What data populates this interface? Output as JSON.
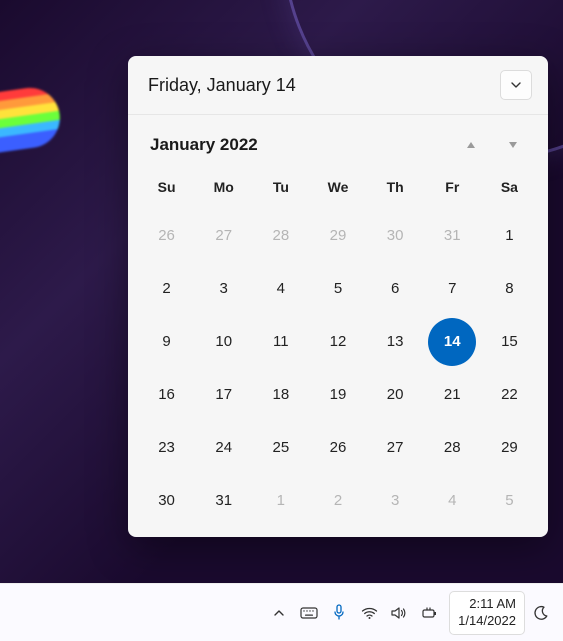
{
  "calendar": {
    "header_date": "Friday, January 14",
    "month_label": "January 2022",
    "days_of_week": [
      "Su",
      "Mo",
      "Tu",
      "We",
      "Th",
      "Fr",
      "Sa"
    ],
    "weeks": [
      [
        {
          "n": 26,
          "m": "out"
        },
        {
          "n": 27,
          "m": "out"
        },
        {
          "n": 28,
          "m": "out"
        },
        {
          "n": 29,
          "m": "out"
        },
        {
          "n": 30,
          "m": "out"
        },
        {
          "n": 31,
          "m": "out"
        },
        {
          "n": 1,
          "m": "in"
        }
      ],
      [
        {
          "n": 2,
          "m": "in"
        },
        {
          "n": 3,
          "m": "in"
        },
        {
          "n": 4,
          "m": "in"
        },
        {
          "n": 5,
          "m": "in"
        },
        {
          "n": 6,
          "m": "in"
        },
        {
          "n": 7,
          "m": "in"
        },
        {
          "n": 8,
          "m": "in"
        }
      ],
      [
        {
          "n": 9,
          "m": "in"
        },
        {
          "n": 10,
          "m": "in"
        },
        {
          "n": 11,
          "m": "in"
        },
        {
          "n": 12,
          "m": "in"
        },
        {
          "n": 13,
          "m": "in"
        },
        {
          "n": 14,
          "m": "today"
        },
        {
          "n": 15,
          "m": "in"
        }
      ],
      [
        {
          "n": 16,
          "m": "in"
        },
        {
          "n": 17,
          "m": "in"
        },
        {
          "n": 18,
          "m": "in"
        },
        {
          "n": 19,
          "m": "in"
        },
        {
          "n": 20,
          "m": "in"
        },
        {
          "n": 21,
          "m": "in"
        },
        {
          "n": 22,
          "m": "in"
        }
      ],
      [
        {
          "n": 23,
          "m": "in"
        },
        {
          "n": 24,
          "m": "in"
        },
        {
          "n": 25,
          "m": "in"
        },
        {
          "n": 26,
          "m": "in"
        },
        {
          "n": 27,
          "m": "in"
        },
        {
          "n": 28,
          "m": "in"
        },
        {
          "n": 29,
          "m": "in"
        }
      ],
      [
        {
          "n": 30,
          "m": "in"
        },
        {
          "n": 31,
          "m": "in"
        },
        {
          "n": 1,
          "m": "out"
        },
        {
          "n": 2,
          "m": "out"
        },
        {
          "n": 3,
          "m": "out"
        },
        {
          "n": 4,
          "m": "out"
        },
        {
          "n": 5,
          "m": "out"
        }
      ]
    ]
  },
  "taskbar": {
    "time": "2:11 AM",
    "date": "1/14/2022"
  }
}
